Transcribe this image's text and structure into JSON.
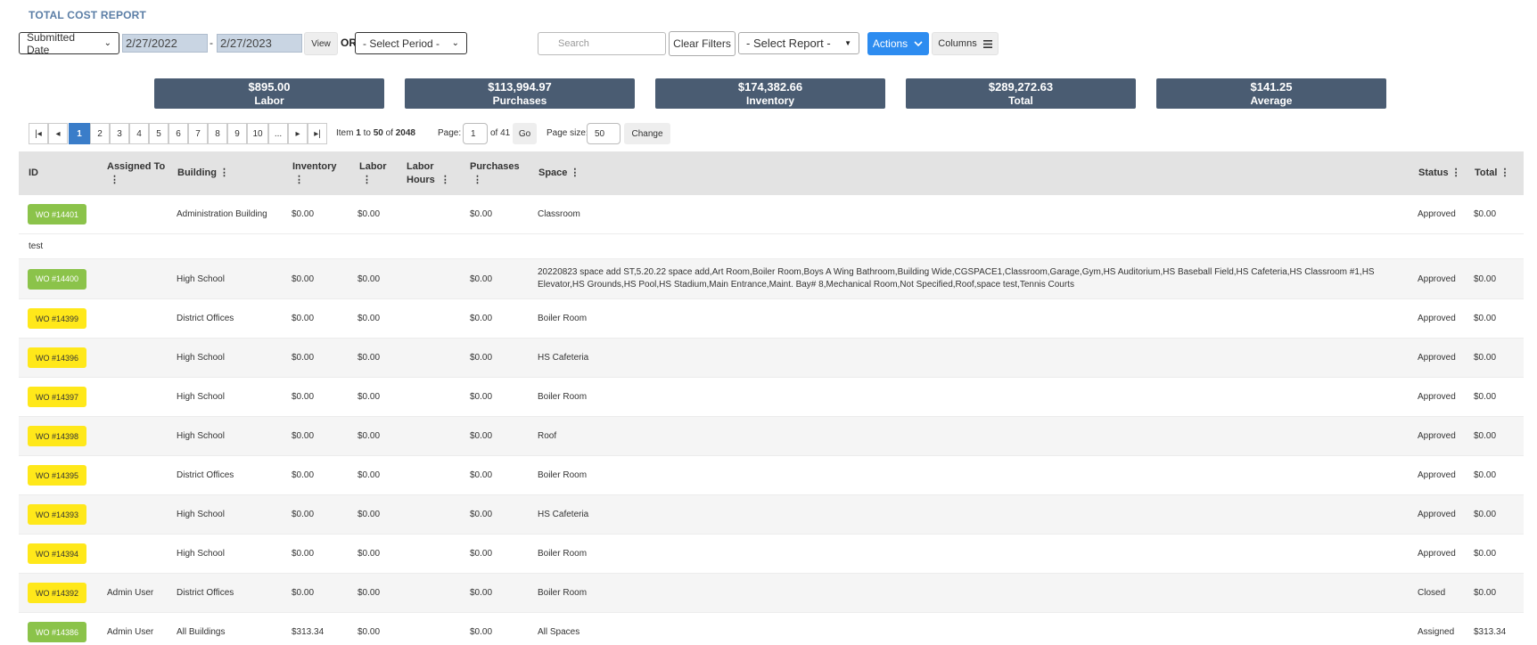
{
  "page": {
    "title": "TOTAL COST REPORT"
  },
  "filters": {
    "date_field": "Submitted Date",
    "date_from": "2/27/2022",
    "date_to": "2/27/2023",
    "date_sep": "-",
    "view_label": "View",
    "or_label": "OR",
    "period_placeholder": "- Select Period -",
    "search_placeholder": "Search",
    "clear_label": "Clear Filters",
    "report_placeholder": "- Select Report -",
    "actions_label": "Actions",
    "columns_label": "Columns"
  },
  "summary": [
    {
      "value": "$895.00",
      "label": "Labor"
    },
    {
      "value": "$113,994.97",
      "label": "Purchases"
    },
    {
      "value": "$174,382.66",
      "label": "Inventory"
    },
    {
      "value": "$289,272.63",
      "label": "Total"
    },
    {
      "value": "$141.25",
      "label": "Average"
    }
  ],
  "pager": {
    "first": "|◂",
    "prev": "◂",
    "pages": [
      "1",
      "2",
      "3",
      "4",
      "5",
      "6",
      "7",
      "8",
      "9",
      "10",
      "..."
    ],
    "next": "▸",
    "last": "▸|",
    "item_prefix": "Item",
    "item_from": "1",
    "item_to_word": "to",
    "item_to": "50",
    "item_of_word": "of",
    "item_total": "2048",
    "page_label": "Page:",
    "page_value": "1",
    "of_pages": "of 41",
    "go_label": "Go",
    "size_label": "Page size:",
    "size_value": "50",
    "change_label": "Change"
  },
  "columns": {
    "id": "ID",
    "assigned_a": "Assigned To",
    "building": "Building",
    "inventory": "Inventory",
    "labor": "Labor",
    "labor_hours_a": "Labor",
    "labor_hours_b": "Hours",
    "purchases": "Purchases",
    "space": "Space",
    "status": "Status",
    "total": "Total",
    "menu": "⋮"
  },
  "rows": [
    {
      "id": "WO #14401",
      "color": "green",
      "assigned": "",
      "building": "Administration Building",
      "inventory": "$0.00",
      "labor": "$0.00",
      "purchases": "$0.00",
      "space": "Classroom",
      "status": "Approved",
      "total": "$0.00"
    },
    {
      "note": "test"
    },
    {
      "id": "WO #14400",
      "color": "green",
      "assigned": "",
      "building": "High School",
      "inventory": "$0.00",
      "labor": "$0.00",
      "purchases": "$0.00",
      "space": "20220823 space add ST,5.20.22 space add,Art Room,Boiler Room,Boys A Wing Bathroom,Building Wide,CGSPACE1,Classroom,Garage,Gym,HS Auditorium,HS Baseball Field,HS Cafeteria,HS Classroom #1,HS Elevator,HS Grounds,HS Pool,HS Stadium,Main Entrance,Maint. Bay# 8,Mechanical Room,Not Specified,Roof,space test,Tennis Courts",
      "status": "Approved",
      "total": "$0.00"
    },
    {
      "id": "WO #14399",
      "color": "yellow",
      "assigned": "",
      "building": "District Offices",
      "inventory": "$0.00",
      "labor": "$0.00",
      "purchases": "$0.00",
      "space": "Boiler Room",
      "status": "Approved",
      "total": "$0.00"
    },
    {
      "id": "WO #14396",
      "color": "yellow",
      "assigned": "",
      "building": "High School",
      "inventory": "$0.00",
      "labor": "$0.00",
      "purchases": "$0.00",
      "space": "HS Cafeteria",
      "status": "Approved",
      "total": "$0.00"
    },
    {
      "id": "WO #14397",
      "color": "yellow",
      "assigned": "",
      "building": "High School",
      "inventory": "$0.00",
      "labor": "$0.00",
      "purchases": "$0.00",
      "space": "Boiler Room",
      "status": "Approved",
      "total": "$0.00"
    },
    {
      "id": "WO #14398",
      "color": "yellow",
      "assigned": "",
      "building": "High School",
      "inventory": "$0.00",
      "labor": "$0.00",
      "purchases": "$0.00",
      "space": "Roof",
      "status": "Approved",
      "total": "$0.00"
    },
    {
      "id": "WO #14395",
      "color": "yellow",
      "assigned": "",
      "building": "District Offices",
      "inventory": "$0.00",
      "labor": "$0.00",
      "purchases": "$0.00",
      "space": "Boiler Room",
      "status": "Approved",
      "total": "$0.00"
    },
    {
      "id": "WO #14393",
      "color": "yellow",
      "assigned": "",
      "building": "High School",
      "inventory": "$0.00",
      "labor": "$0.00",
      "purchases": "$0.00",
      "space": "HS Cafeteria",
      "status": "Approved",
      "total": "$0.00"
    },
    {
      "id": "WO #14394",
      "color": "yellow",
      "assigned": "",
      "building": "High School",
      "inventory": "$0.00",
      "labor": "$0.00",
      "purchases": "$0.00",
      "space": "Boiler Room",
      "status": "Approved",
      "total": "$0.00"
    },
    {
      "id": "WO #14392",
      "color": "yellow",
      "assigned": "Admin User",
      "building": "District Offices",
      "inventory": "$0.00",
      "labor": "$0.00",
      "purchases": "$0.00",
      "space": "Boiler Room",
      "status": "Closed",
      "total": "$0.00"
    },
    {
      "id": "WO #14386",
      "color": "green",
      "assigned": "Admin User",
      "building": "All Buildings",
      "inventory": "$313.34",
      "labor": "$0.00",
      "purchases": "$0.00",
      "space": "All Spaces",
      "status": "Assigned",
      "total": "$313.34"
    }
  ],
  "colors": {
    "accent": "#2d8cf0",
    "title": "#5b7ea6",
    "card": "#4a5c72",
    "badge_green": "#8bc34a",
    "badge_yellow": "#ffe81a",
    "active_page": "#3a7dc9"
  }
}
